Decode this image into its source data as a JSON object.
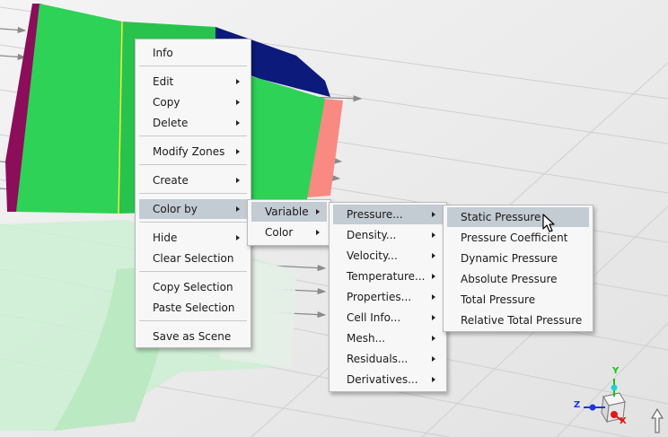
{
  "context_menu": {
    "items": [
      {
        "label": "Info",
        "submenu": false
      },
      {
        "label": "Edit",
        "submenu": true
      },
      {
        "label": "Copy",
        "submenu": true
      },
      {
        "label": "Delete",
        "submenu": true
      },
      {
        "label": "Modify Zones",
        "submenu": true
      },
      {
        "label": "Create",
        "submenu": true
      },
      {
        "label": "Color by",
        "submenu": true,
        "highlighted": true
      },
      {
        "label": "Hide",
        "submenu": true
      },
      {
        "label": "Clear Selection",
        "submenu": false
      },
      {
        "label": "Copy Selection",
        "submenu": false
      },
      {
        "label": "Paste Selection",
        "submenu": false
      },
      {
        "label": "Save as Scene",
        "submenu": false
      }
    ]
  },
  "color_by_menu": {
    "items": [
      {
        "label": "Variable",
        "submenu": true,
        "highlighted": true
      },
      {
        "label": "Color",
        "submenu": true
      }
    ]
  },
  "variable_menu": {
    "items": [
      {
        "label": "Pressure...",
        "submenu": true,
        "highlighted": true
      },
      {
        "label": "Density...",
        "submenu": true
      },
      {
        "label": "Velocity...",
        "submenu": true
      },
      {
        "label": "Temperature...",
        "submenu": true
      },
      {
        "label": "Properties...",
        "submenu": true
      },
      {
        "label": "Cell Info...",
        "submenu": true
      },
      {
        "label": "Mesh...",
        "submenu": true
      },
      {
        "label": "Residuals...",
        "submenu": true
      },
      {
        "label": "Derivatives...",
        "submenu": true
      }
    ]
  },
  "pressure_menu": {
    "items": [
      {
        "label": "Static Pressure",
        "highlighted": true
      },
      {
        "label": "Pressure Coefficient"
      },
      {
        "label": "Dynamic Pressure"
      },
      {
        "label": "Absolute Pressure"
      },
      {
        "label": "Total Pressure"
      },
      {
        "label": "Relative Total Pressure"
      }
    ]
  },
  "triad": {
    "x_label": "X",
    "y_label": "Y",
    "z_label": "Z"
  },
  "colors": {
    "face_green": "#2ed256",
    "face_magenta": "#8c0d5a",
    "face_navy": "#0c1a7c",
    "face_salmon": "#f88a82",
    "menu_bg": "#f7f7f7",
    "menu_highlight": "#c3cbd3"
  }
}
